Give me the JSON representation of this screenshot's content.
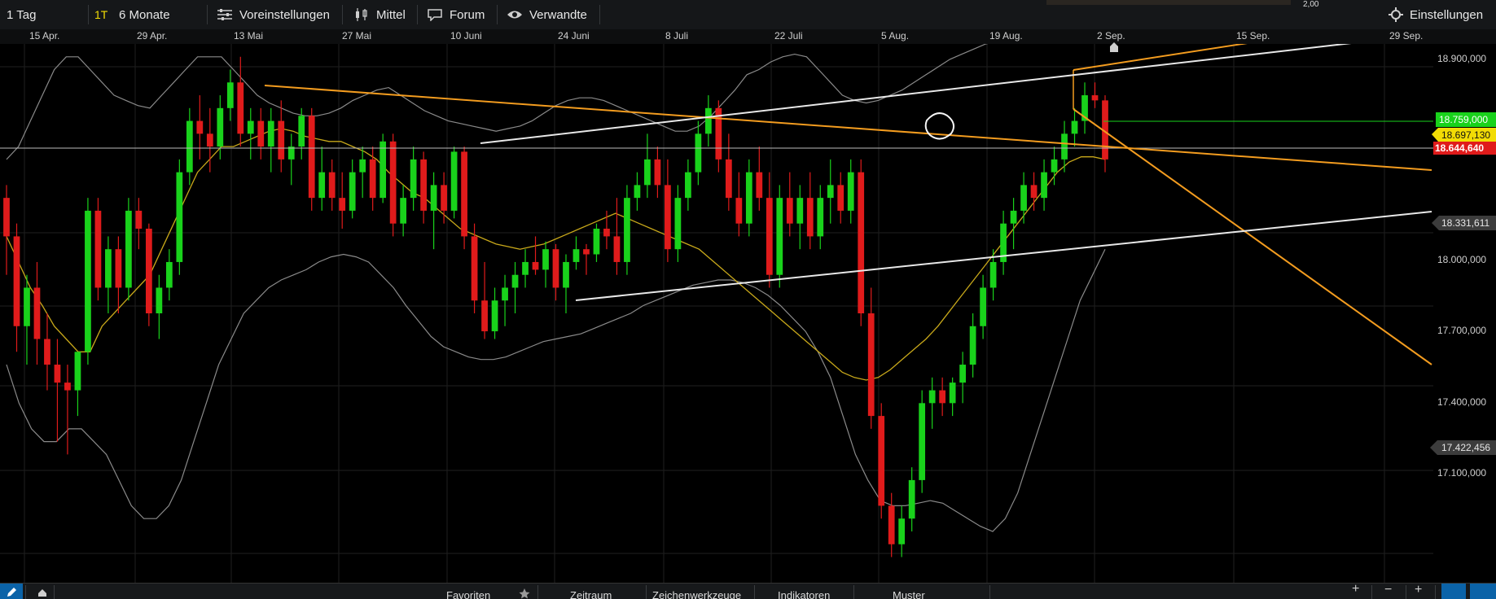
{
  "toolbar": {
    "interval": "1 Tag",
    "interval_badge": "1T",
    "range": "6 Monate",
    "presets": "Voreinstellungen",
    "chart_type": "Mittel",
    "forum": "Forum",
    "related": "Verwandte",
    "settings": "Einstellungen",
    "stub_value": "2,00"
  },
  "time_axis": [
    "15 Apr.",
    "29 Apr.",
    "13 Mai",
    "27 Mai",
    "10 Juni",
    "24 Juni",
    "8 Juli",
    "22 Juli",
    "5 Aug.",
    "19 Aug.",
    "2 Sep.",
    "15 Sep.",
    "29 Sep."
  ],
  "price_axis": [
    "18.900,000",
    "18.000,000",
    "17.700,000",
    "17.400,000",
    "17.100,000"
  ],
  "price_markers": {
    "green": "18.759,000",
    "yellow": "18.697,130",
    "red": "18.644,640",
    "upper": "18.331,611",
    "lower": "17.422,456"
  },
  "colors": {
    "up": "#19d21b",
    "down": "#e01b1b",
    "ma": "#c8a81a",
    "band": "#8a8a8a",
    "trend_orange": "#f39c1f",
    "trend_white": "#e8e8e8",
    "marker_green": "#19d21b",
    "marker_yellow": "#f2dc05",
    "marker_red": "#e01b1b",
    "marker_gray": "#3c3c3c"
  },
  "bottom": {
    "favorites": "Favoriten",
    "period": "Zeitraum",
    "drawing_tools": "Zeichenwerkzeuge",
    "indicators": "Indikatoren",
    "patterns": "Muster"
  },
  "chart_data": {
    "type": "candlestick",
    "y_range": [
      17000,
      19100
    ],
    "candles": [
      [
        18500,
        18550,
        18200,
        18350
      ],
      [
        18350,
        18400,
        17900,
        18000
      ],
      [
        18000,
        18200,
        17850,
        18150
      ],
      [
        18150,
        18250,
        17850,
        17950
      ],
      [
        17950,
        18050,
        17750,
        17850
      ],
      [
        17850,
        17950,
        17550,
        17780
      ],
      [
        17780,
        17850,
        17500,
        17750
      ],
      [
        17750,
        17900,
        17650,
        17900
      ],
      [
        17900,
        18500,
        17850,
        18450
      ],
      [
        18450,
        18500,
        18100,
        18150
      ],
      [
        18150,
        18350,
        18050,
        18300
      ],
      [
        18300,
        18350,
        18050,
        18150
      ],
      [
        18150,
        18500,
        18100,
        18450
      ],
      [
        18450,
        18500,
        18300,
        18380
      ],
      [
        18380,
        18400,
        18000,
        18050
      ],
      [
        18050,
        18200,
        17950,
        18150
      ],
      [
        18150,
        18300,
        18100,
        18250
      ],
      [
        18250,
        18650,
        18200,
        18600
      ],
      [
        18600,
        18850,
        18550,
        18800
      ],
      [
        18800,
        18900,
        18650,
        18750
      ],
      [
        18750,
        18850,
        18600,
        18700
      ],
      [
        18700,
        18900,
        18650,
        18850
      ],
      [
        18850,
        19000,
        18800,
        18950
      ],
      [
        18950,
        19050,
        18700,
        18750
      ],
      [
        18750,
        18850,
        18650,
        18800
      ],
      [
        18800,
        18850,
        18650,
        18700
      ],
      [
        18700,
        18850,
        18600,
        18800
      ],
      [
        18800,
        18880,
        18600,
        18650
      ],
      [
        18650,
        18750,
        18550,
        18700
      ],
      [
        18700,
        18850,
        18650,
        18820
      ],
      [
        18820,
        18850,
        18450,
        18500
      ],
      [
        18500,
        18700,
        18450,
        18600
      ],
      [
        18600,
        18650,
        18450,
        18500
      ],
      [
        18500,
        18600,
        18380,
        18450
      ],
      [
        18450,
        18650,
        18420,
        18600
      ],
      [
        18600,
        18700,
        18500,
        18650
      ],
      [
        18650,
        18700,
        18450,
        18500
      ],
      [
        18500,
        18750,
        18480,
        18720
      ],
      [
        18720,
        18750,
        18350,
        18400
      ],
      [
        18400,
        18550,
        18350,
        18500
      ],
      [
        18500,
        18700,
        18450,
        18650
      ],
      [
        18650,
        18680,
        18400,
        18450
      ],
      [
        18450,
        18600,
        18300,
        18550
      ],
      [
        18550,
        18600,
        18400,
        18450
      ],
      [
        18450,
        18700,
        18420,
        18680
      ],
      [
        18680,
        18700,
        18300,
        18350
      ],
      [
        18350,
        18400,
        18050,
        18100
      ],
      [
        18100,
        18250,
        17950,
        17980
      ],
      [
        17980,
        18150,
        17950,
        18100
      ],
      [
        18100,
        18200,
        18000,
        18150
      ],
      [
        18150,
        18250,
        18050,
        18200
      ],
      [
        18200,
        18300,
        18150,
        18250
      ],
      [
        18250,
        18350,
        18200,
        18220
      ],
      [
        18220,
        18330,
        18150,
        18300
      ],
      [
        18300,
        18320,
        18100,
        18150
      ],
      [
        18150,
        18280,
        18050,
        18250
      ],
      [
        18250,
        18350,
        18220,
        18300
      ],
      [
        18300,
        18320,
        18200,
        18280
      ],
      [
        18280,
        18400,
        18250,
        18380
      ],
      [
        18380,
        18450,
        18300,
        18350
      ],
      [
        18350,
        18500,
        18200,
        18250
      ],
      [
        18250,
        18550,
        18200,
        18500
      ],
      [
        18500,
        18600,
        18450,
        18550
      ],
      [
        18550,
        18750,
        18500,
        18650
      ],
      [
        18650,
        18700,
        18500,
        18550
      ],
      [
        18550,
        18650,
        18250,
        18300
      ],
      [
        18300,
        18550,
        18250,
        18500
      ],
      [
        18500,
        18650,
        18450,
        18600
      ],
      [
        18600,
        18800,
        18550,
        18750
      ],
      [
        18750,
        18900,
        18700,
        18850
      ],
      [
        18850,
        18880,
        18600,
        18650
      ],
      [
        18650,
        18750,
        18450,
        18500
      ],
      [
        18500,
        18600,
        18350,
        18400
      ],
      [
        18400,
        18650,
        18350,
        18600
      ],
      [
        18600,
        18700,
        18450,
        18500
      ],
      [
        18500,
        18600,
        18150,
        18200
      ],
      [
        18200,
        18550,
        18150,
        18500
      ],
      [
        18500,
        18600,
        18350,
        18400
      ],
      [
        18400,
        18550,
        18300,
        18500
      ],
      [
        18500,
        18600,
        18300,
        18350
      ],
      [
        18350,
        18550,
        18300,
        18500
      ],
      [
        18500,
        18650,
        18400,
        18550
      ],
      [
        18550,
        18600,
        18400,
        18450
      ],
      [
        18450,
        18650,
        18400,
        18600
      ],
      [
        18600,
        18650,
        18000,
        18050
      ],
      [
        18050,
        18150,
        17600,
        17650
      ],
      [
        17650,
        17700,
        17250,
        17300
      ],
      [
        17300,
        17350,
        17100,
        17150
      ],
      [
        17150,
        17300,
        17100,
        17250
      ],
      [
        17250,
        17450,
        17200,
        17400
      ],
      [
        17400,
        17750,
        17350,
        17700
      ],
      [
        17700,
        17800,
        17600,
        17750
      ],
      [
        17750,
        17800,
        17650,
        17700
      ],
      [
        17700,
        17800,
        17650,
        17780
      ],
      [
        17780,
        17900,
        17700,
        17850
      ],
      [
        17850,
        18050,
        17800,
        18000
      ],
      [
        18000,
        18200,
        17950,
        18150
      ],
      [
        18150,
        18300,
        18100,
        18250
      ],
      [
        18250,
        18450,
        18200,
        18400
      ],
      [
        18400,
        18500,
        18300,
        18450
      ],
      [
        18450,
        18600,
        18400,
        18550
      ],
      [
        18550,
        18600,
        18450,
        18500
      ],
      [
        18500,
        18650,
        18450,
        18600
      ],
      [
        18600,
        18700,
        18550,
        18650
      ],
      [
        18650,
        18800,
        18600,
        18750
      ],
      [
        18750,
        18850,
        18700,
        18800
      ],
      [
        18800,
        18950,
        18750,
        18900
      ],
      [
        18900,
        18950,
        18850,
        18880
      ],
      [
        18880,
        18900,
        18600,
        18650
      ]
    ],
    "ma": [
      18350,
      18250,
      18150,
      18080,
      18000,
      17950,
      17900,
      17900,
      18000,
      18050,
      18100,
      18150,
      18200,
      18300,
      18400,
      18500,
      18600,
      18650,
      18700,
      18700,
      18720,
      18740,
      18760,
      18770,
      18760,
      18740,
      18730,
      18720,
      18720,
      18700,
      18680,
      18650,
      18600,
      18560,
      18520,
      18500,
      18460,
      18420,
      18380,
      18360,
      18340,
      18320,
      18310,
      18300,
      18310,
      18320,
      18340,
      18360,
      18380,
      18400,
      18420,
      18440,
      18420,
      18400,
      18380,
      18360,
      18340,
      18320,
      18300,
      18260,
      18220,
      18180,
      18140,
      18100,
      18060,
      18020,
      17980,
      17940,
      17900,
      17860,
      17820,
      17800,
      17790,
      17800,
      17830,
      17870,
      17910,
      17950,
      18000,
      18060,
      18120,
      18180,
      18240,
      18300,
      18360,
      18420,
      18480,
      18540,
      18600,
      18640,
      18660,
      18660,
      18650
    ],
    "band_upper": [
      18650,
      18700,
      18800,
      18900,
      19000,
      19050,
      19050,
      19000,
      18950,
      18900,
      18880,
      18860,
      18850,
      18900,
      18950,
      19000,
      19050,
      19050,
      19050,
      19000,
      18950,
      18900,
      18870,
      18850,
      18830,
      18820,
      18820,
      18830,
      18850,
      18880,
      18900,
      18920,
      18930,
      18900,
      18870,
      18840,
      18820,
      18800,
      18790,
      18780,
      18770,
      18760,
      18770,
      18780,
      18800,
      18830,
      18860,
      18880,
      18890,
      18890,
      18880,
      18860,
      18840,
      18820,
      18800,
      18780,
      18760,
      18760,
      18780,
      18820,
      18870,
      18920,
      18980,
      19000,
      19030,
      19050,
      19060,
      19050,
      19000,
      18950,
      18900,
      18880,
      18870,
      18880,
      18900,
      18920,
      18950,
      18980,
      19010,
      19040,
      19060,
      19080,
      19100,
      19110,
      19120,
      19120,
      19120,
      19130,
      19130,
      19130,
      19130,
      19130,
      19130
    ],
    "band_lower": [
      17850,
      17700,
      17600,
      17550,
      17550,
      17600,
      17600,
      17550,
      17500,
      17400,
      17300,
      17250,
      17250,
      17300,
      17400,
      17550,
      17700,
      17850,
      17950,
      18050,
      18100,
      18150,
      18180,
      18200,
      18220,
      18250,
      18270,
      18280,
      18270,
      18250,
      18200,
      18150,
      18080,
      18020,
      17960,
      17920,
      17900,
      17880,
      17870,
      17870,
      17880,
      17900,
      17920,
      17940,
      17950,
      17960,
      17970,
      17990,
      18010,
      18030,
      18050,
      18080,
      18100,
      18120,
      18140,
      18160,
      18170,
      18180,
      18180,
      18170,
      18150,
      18120,
      18080,
      18030,
      17980,
      17900,
      17800,
      17650,
      17500,
      17400,
      17320,
      17300,
      17300,
      17310,
      17320,
      17310,
      17280,
      17250,
      17220,
      17200,
      17250,
      17350,
      17500,
      17650,
      17800,
      17950,
      18100,
      18200,
      18300
    ]
  }
}
